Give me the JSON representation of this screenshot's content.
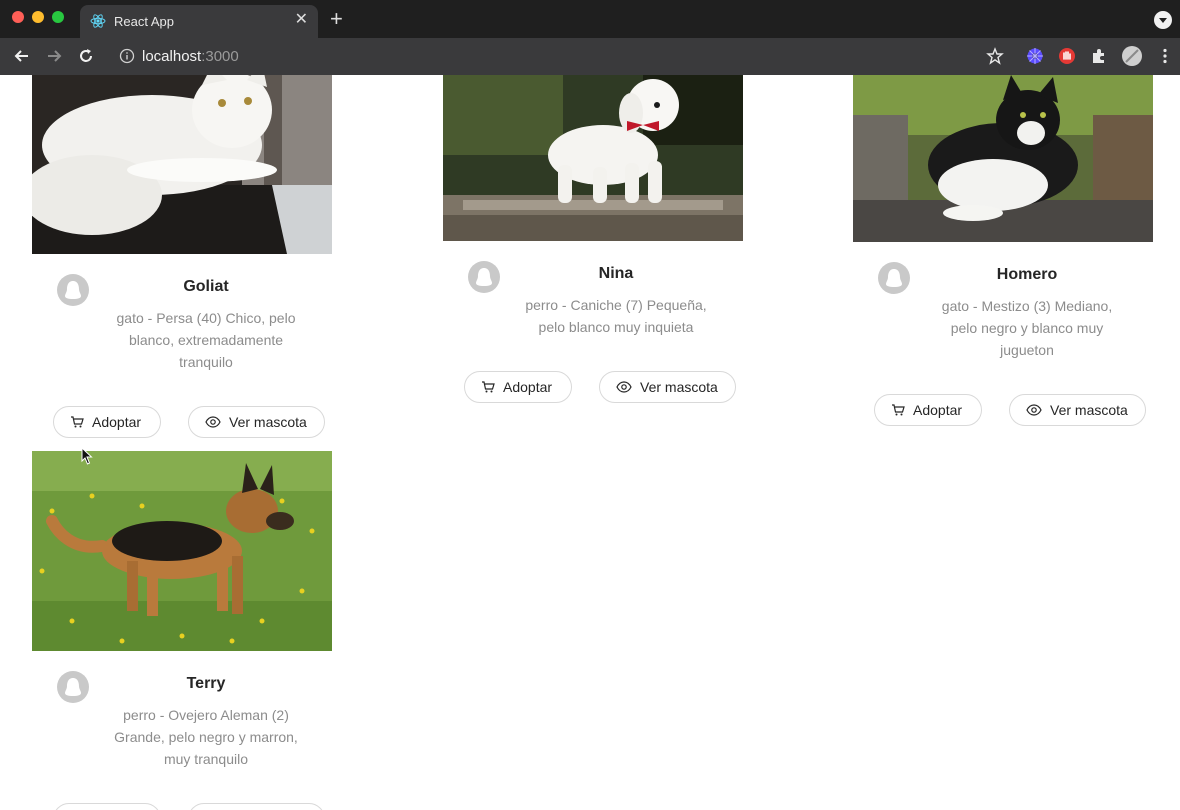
{
  "browser": {
    "tab_title": "React App",
    "url_host": "localhost",
    "url_port": ":3000"
  },
  "actions": {
    "adopt_label": "Adoptar",
    "view_label": "Ver mascota"
  },
  "pets": [
    {
      "name": "Goliat",
      "description": "gato - Persa (40) Chico, pelo blanco, extremadamente tranquilo",
      "desc_lines": [
        "gato - Persa (40) Chico, pelo",
        "blanco, extremadamente",
        "tranquilo"
      ],
      "image": "white-persian-cat-photo"
    },
    {
      "name": "Nina",
      "description": "perro - Caniche (7) Pequeña, pelo blanco muy inquieta",
      "desc_lines": [
        "perro - Caniche (7) Pequeña,",
        "pelo blanco muy inquieta"
      ],
      "image": "white-poodle-photo"
    },
    {
      "name": "Homero",
      "description": "gato - Mestizo (3) Mediano, pelo negro y blanco muy jugueton",
      "desc_lines": [
        "gato - Mestizo (3) Mediano,",
        "pelo negro y blanco muy",
        "jugueton"
      ],
      "image": "black-white-cat-photo"
    },
    {
      "name": "Terry",
      "description": "perro - Ovejero Aleman (2) Grande, pelo negro y marron, muy tranquilo",
      "desc_lines": [
        "perro - Ovejero Aleman (2)",
        "Grande, pelo negro y marron,",
        "muy tranquilo"
      ],
      "image": "german-shepherd-photo"
    }
  ],
  "colors": {
    "chrome_dark": "#1f1f1f",
    "chrome_toolbar": "#3a3a3c",
    "border": "#d9d9d9",
    "text": "#262626",
    "muted": "#8c8c8c",
    "avatar": "#c9c9c9"
  }
}
